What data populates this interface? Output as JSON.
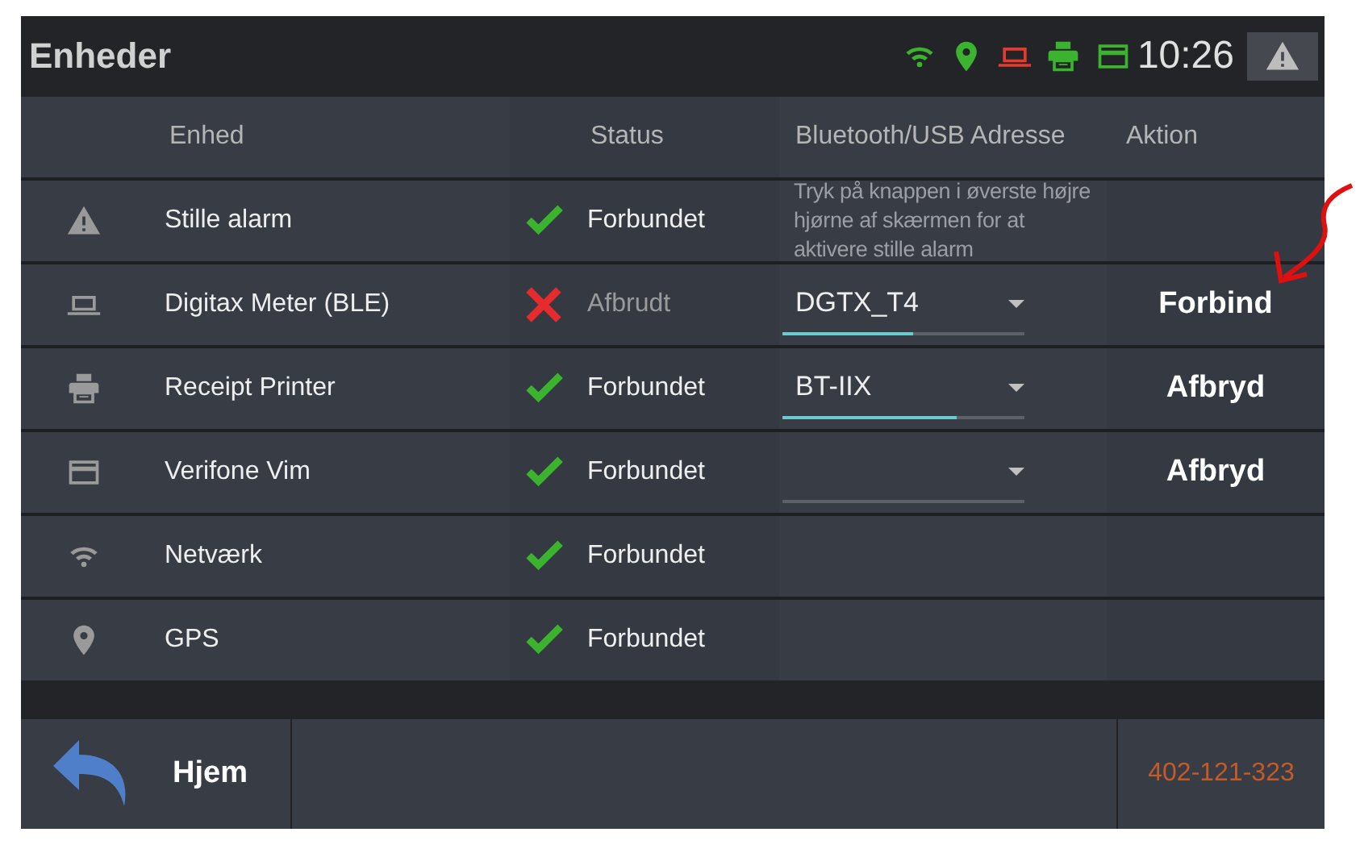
{
  "window": {
    "title": "Enheder"
  },
  "status_bar": {
    "icons": [
      {
        "kind": "wifi",
        "color": "#3cb32e"
      },
      {
        "kind": "pin",
        "color": "#3cb32e"
      },
      {
        "kind": "meter",
        "color": "#e53a2c"
      },
      {
        "kind": "printer",
        "color": "#3cb32e"
      },
      {
        "kind": "card",
        "color": "#3cb32e"
      }
    ],
    "time": "10:26"
  },
  "table": {
    "columns": [
      "Enhed",
      "Status",
      "Bluetooth/USB Adresse",
      "Aktion"
    ],
    "rows": [
      {
        "kind": "alert",
        "name": "Stille alarm",
        "connected": true,
        "status": "Forbundet",
        "address": {
          "kind": "note",
          "text": "Tryk på knappen i øverste højre hjørne af skærmen for at aktivere stille alarm"
        }
      },
      {
        "kind": "meter",
        "name": "Digitax Meter (BLE)",
        "connected": false,
        "status": "Afbrudt",
        "address": {
          "kind": "dropdown",
          "value": "DGTX_T4",
          "level": 0.54
        },
        "action": "Forbind"
      },
      {
        "kind": "printer",
        "name": "Receipt Printer",
        "connected": true,
        "status": "Forbundet",
        "address": {
          "kind": "dropdown",
          "value": "BT-IIX",
          "level": 0.72
        },
        "action": "Afbryd"
      },
      {
        "kind": "card",
        "name": "Verifone Vim",
        "connected": true,
        "status": "Forbundet",
        "address": {
          "kind": "dropdown"
        },
        "action": "Afbryd"
      },
      {
        "kind": "wifi",
        "name": "Netværk",
        "connected": true,
        "status": "Forbundet",
        "address": {
          "kind": "empty"
        }
      },
      {
        "kind": "pin",
        "name": "GPS",
        "connected": true,
        "status": "Forbundet",
        "address": {
          "kind": "empty"
        }
      }
    ]
  },
  "footer": {
    "home": "Hjem",
    "id": "402-121-323"
  }
}
